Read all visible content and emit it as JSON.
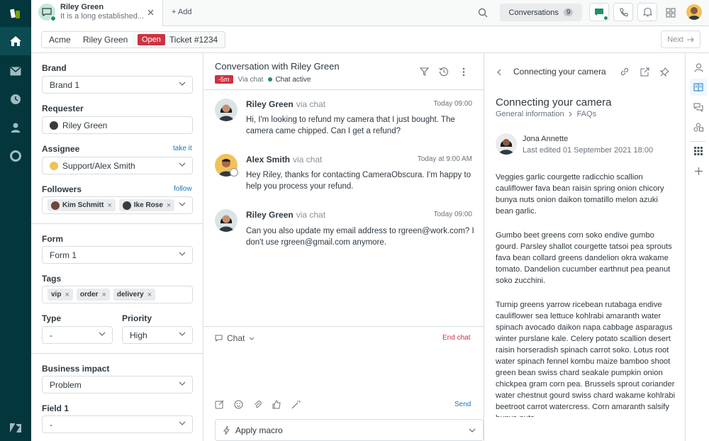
{
  "tab": {
    "title": "Riley Green",
    "subtitle": "It is a long established...",
    "add_label": "+ Add"
  },
  "topbar": {
    "conversations_label": "Conversations",
    "conversations_count": "9"
  },
  "breadcrumb": {
    "org": "Acme",
    "requester": "Riley Green",
    "status": "Open",
    "ticket": "Ticket #1234",
    "next_label": "Next"
  },
  "props": {
    "brand_label": "Brand",
    "brand_value": "Brand 1",
    "requester_label": "Requester",
    "requester_value": "Riley Green",
    "assignee_label": "Assignee",
    "assignee_link": "take it",
    "assignee_value": "Support/Alex Smith",
    "followers_label": "Followers",
    "followers_link": "follow",
    "followers": [
      "Kim Schmitt",
      "Ike Rose"
    ],
    "form_label": "Form",
    "form_value": "Form 1",
    "tags_label": "Tags",
    "tags": [
      "vip",
      "order",
      "delivery"
    ],
    "type_label": "Type",
    "type_value": "-",
    "priority_label": "Priority",
    "priority_value": "High",
    "impact_label": "Business impact",
    "impact_value": "Problem",
    "field1_label": "Field 1",
    "field1_value": "-"
  },
  "conversation": {
    "title": "Conversation with Riley Green",
    "sla_badge": "-5m",
    "via": "Via chat",
    "status": "Chat active",
    "messages": [
      {
        "name": "Riley Green",
        "via": "via chat",
        "time": "Today 09:00",
        "text": "Hi, I'm looking to refund my camera that I just bought. The camera came chipped. Can I get a refund?"
      },
      {
        "name": "Alex Smith",
        "via": "via chat",
        "time": "Today at 9:00 AM",
        "text": "Hey Riley, thanks for contacting CameraObscura. I'm happy to help you process your refund."
      },
      {
        "name": "Riley Green",
        "via": "via chat",
        "time": "Today 09:00",
        "text": "Can you also update my email address to rgreen@work.com? I don't use rgreen@gmail.com anymore."
      }
    ],
    "composer_channel": "Chat",
    "end_chat": "End chat",
    "send": "Send",
    "macro_label": "Apply macro"
  },
  "knowledge": {
    "header_title": "Connecting your camera",
    "article_title": "Connecting your camera",
    "crumb_section": "General information",
    "crumb_sub": "FAQs",
    "author": "Jona Annette",
    "edited": "Last edited 01 September 2021 18:00",
    "paragraphs": [
      "Veggies garlic courgette radicchio scallion cauliflower fava bean raisin spring onion chicory bunya nuts onion daikon tomatillo melon azuki bean garlic.",
      "Gumbo beet greens corn soko endive gumbo gourd. Parsley shallot courgette tatsoi pea sprouts fava bean collard greens dandelion okra wakame tomato. Dandelion cucumber earthnut pea peanut soko zucchini.",
      "Turnip greens yarrow ricebean rutabaga endive cauliflower sea lettuce kohlrabi amaranth water spinach avocado daikon napa cabbage asparagus winter purslane kale. Celery potato scallion desert raisin horseradish spinach carrot soko. Lotus root water spinach fennel kombu maize bamboo shoot green bean swiss chard seakale pumpkin onion chickpea gram corn pea. Brussels sprout coriander water chestnut gourd swiss chard wakame kohlrabi beetroot carrot watercress. Corn amaranth salsify bunya nuts"
    ]
  },
  "colors": {
    "nav_bg": "#03363d",
    "accent": "#1f73b7",
    "danger": "#cc3340",
    "success": "#228f67"
  }
}
